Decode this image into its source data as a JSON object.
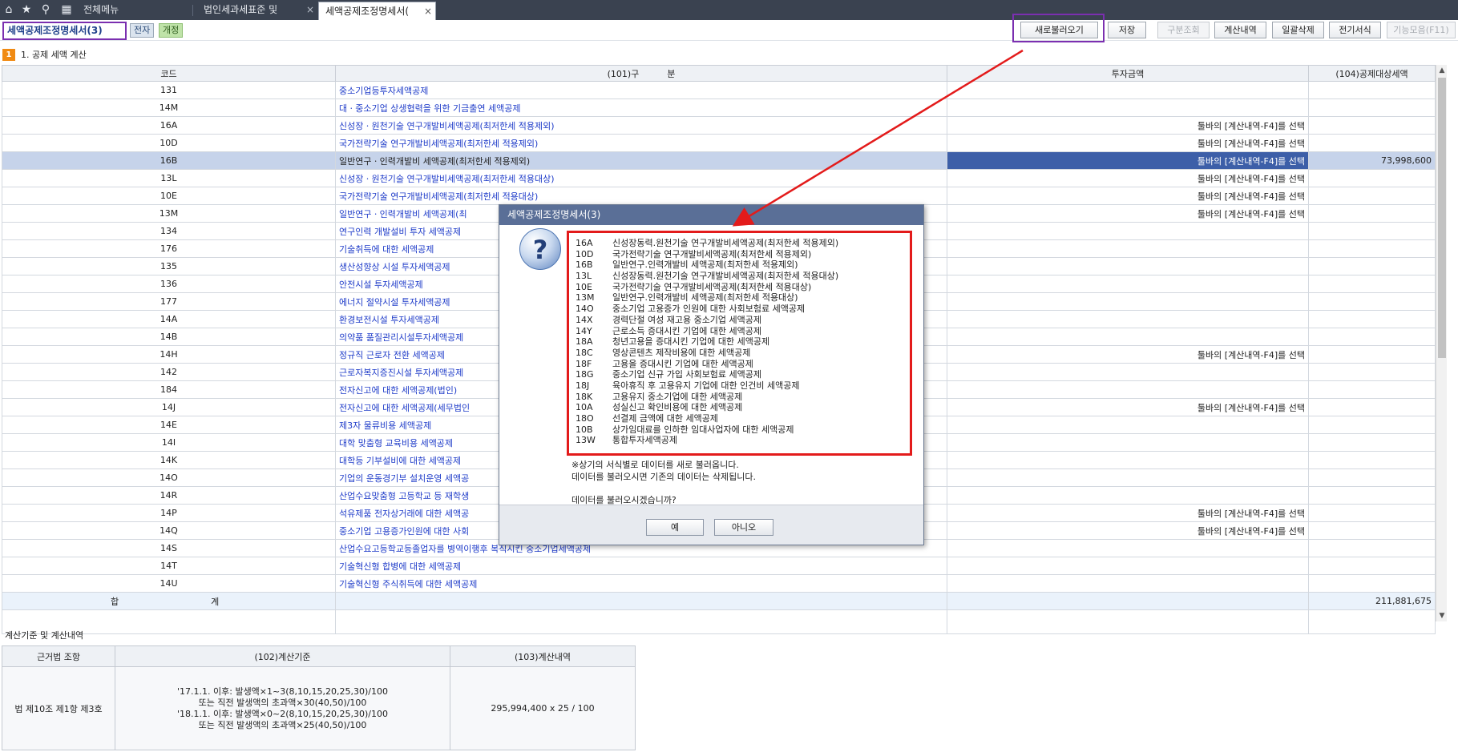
{
  "topbar": {
    "icons": [
      "home-icon",
      "star-icon",
      "search-icon",
      "calendar-icon"
    ],
    "tabs": [
      {
        "label": "전체메뉴",
        "active": false
      },
      {
        "label": "법인세과세표준 및",
        "active": false
      },
      {
        "label": "세액공제조정명세서(",
        "active": true
      }
    ],
    "close_glyph": "×"
  },
  "toolbar": {
    "form_title": "세액공제조정명세서(3)",
    "chip_electronic": "전자",
    "chip_revised": "개정",
    "buttons": [
      {
        "label": "새로불러오기",
        "disabled": false
      },
      {
        "label": "저장",
        "disabled": false
      },
      {
        "label": "구분조회",
        "disabled": true
      },
      {
        "label": "계산내역",
        "disabled": false
      },
      {
        "label": "일괄삭제",
        "disabled": false
      },
      {
        "label": "전기서식",
        "disabled": false
      },
      {
        "label": "기능모음(F11)",
        "disabled": true
      }
    ]
  },
  "section1": {
    "number": "1",
    "title": "1. 공제 세액 계산"
  },
  "grid": {
    "headers": {
      "code": "코드",
      "name": "(101)구          분",
      "invest": "투자금액",
      "deduct": "(104)공제대상세액"
    },
    "rows": [
      {
        "code": "131",
        "name": "중소기업등투자세액공제",
        "invest": "",
        "deduct": ""
      },
      {
        "code": "14M",
        "name": "대ㆍ중소기업 상생협력을 위한 기금출연 세액공제",
        "invest": "",
        "deduct": ""
      },
      {
        "code": "16A",
        "name": "신성장ㆍ원천기술 연구개발비세액공제(최저한세 적용제외)",
        "invest": "툴바의 [계산내역-F4]를 선택",
        "deduct": ""
      },
      {
        "code": "10D",
        "name": "국가전략기술 연구개발비세액공제(최저한세 적용제외)",
        "invest": "툴바의 [계산내역-F4]를 선택",
        "deduct": ""
      },
      {
        "code": "16B",
        "name": "일반연구ㆍ인력개발비 세액공제(최저한세 적용제외)",
        "invest": "툴바의 [계산내역-F4]를 선택",
        "deduct": "73,998,600",
        "selected": true
      },
      {
        "code": "13L",
        "name": "신성장ㆍ원천기술 연구개발비세액공제(최저한세 적용대상)",
        "invest": "툴바의 [계산내역-F4]를 선택",
        "deduct": ""
      },
      {
        "code": "10E",
        "name": "국가전략기술 연구개발비세액공제(최저한세 적용대상)",
        "invest": "툴바의 [계산내역-F4]를 선택",
        "deduct": ""
      },
      {
        "code": "13M",
        "name": "일반연구ㆍ인력개발비 세액공제(최",
        "invest": "툴바의 [계산내역-F4]를 선택",
        "deduct": ""
      },
      {
        "code": "134",
        "name": "연구인력 개발설비 투자 세액공제",
        "invest": "",
        "deduct": ""
      },
      {
        "code": "176",
        "name": "기술취득에 대한 세액공제",
        "invest": "",
        "deduct": ""
      },
      {
        "code": "135",
        "name": "생산성향상 시설 투자세액공제",
        "invest": "",
        "deduct": ""
      },
      {
        "code": "136",
        "name": "안전시설 투자세액공제",
        "invest": "",
        "deduct": ""
      },
      {
        "code": "177",
        "name": "에너지 절약시설 투자세액공제",
        "invest": "",
        "deduct": ""
      },
      {
        "code": "14A",
        "name": "환경보전시설 투자세액공제",
        "invest": "",
        "deduct": ""
      },
      {
        "code": "14B",
        "name": "의약품 품질관리시설투자세액공제",
        "invest": "",
        "deduct": ""
      },
      {
        "code": "14H",
        "name": "정규직 근로자 전환 세액공제",
        "invest": "툴바의 [계산내역-F4]를 선택",
        "deduct": ""
      },
      {
        "code": "142",
        "name": "근로자복지증진시설 투자세액공제",
        "invest": "",
        "deduct": ""
      },
      {
        "code": "184",
        "name": "전자신고에 대한 세액공제(법인)",
        "invest": "",
        "deduct": ""
      },
      {
        "code": "14J",
        "name": "전자신고에 대한 세액공제(세무법인",
        "invest": "툴바의 [계산내역-F4]를 선택",
        "deduct": ""
      },
      {
        "code": "14E",
        "name": "제3자 물류비용 세액공제",
        "invest": "",
        "deduct": ""
      },
      {
        "code": "14I",
        "name": "대학 맞춤형 교육비용 세액공제",
        "invest": "",
        "deduct": ""
      },
      {
        "code": "14K",
        "name": "대학등 기부설비에 대한 세액공제",
        "invest": "",
        "deduct": ""
      },
      {
        "code": "14O",
        "name": "기업의 운동경기부 설치운영 세액공",
        "invest": "",
        "deduct": ""
      },
      {
        "code": "14R",
        "name": "산업수요맞춤형 고등학교 등 재학생",
        "invest": "",
        "deduct": ""
      },
      {
        "code": "14P",
        "name": "석유제품 전자상거래에 대한 세액공",
        "invest": "툴바의 [계산내역-F4]를 선택",
        "deduct": ""
      },
      {
        "code": "14Q",
        "name": "중소기업 고용증가인원에 대한 사회",
        "invest": "툴바의 [계산내역-F4]를 선택",
        "deduct": ""
      },
      {
        "code": "14S",
        "name": "산업수요고등학교등졸업자를 병역이행후 복직시킨 중소기업세액공제",
        "invest": "",
        "deduct": ""
      },
      {
        "code": "14T",
        "name": "기술혁신형 합병에 대한 세액공제",
        "invest": "",
        "deduct": ""
      },
      {
        "code": "14U",
        "name": "기술혁신형 주식취득에 대한 세액공제",
        "invest": "",
        "deduct": ""
      }
    ],
    "total": {
      "label_left": "합",
      "label_right": "계",
      "deduct": "211,881,675"
    }
  },
  "bottom": {
    "title": "계산기준 및 계산내역",
    "headers": {
      "law": "근거법 조항",
      "basis": "(102)계산기준",
      "calc": "(103)계산내역"
    },
    "row": {
      "law": "법 제10조 제1항 제3호",
      "basis_lines": [
        "'17.1.1. 이후: 발생액×1~3(8,10,15,20,25,30)/100",
        "또는 직전 발생액의 초과액×30(40,50)/100",
        "'18.1.1. 이후: 발생액×0~2(8,10,15,20,25,30)/100",
        "또는 직전 발생액의 초과액×25(40,50)/100"
      ],
      "calc": "295,994,400 x 25 / 100"
    }
  },
  "dialog": {
    "title": "세액공제조정명세서(3)",
    "icon": "question-icon",
    "items": [
      {
        "code": "16A",
        "name": "신성장동력.원천기술 연구개발비세액공제(최저한세 적용제외)"
      },
      {
        "code": "10D",
        "name": "국가전략기술 연구개발비세액공제(최저한세 적용제외)"
      },
      {
        "code": "16B",
        "name": "일반연구.인력개발비 세액공제(최저한세 적용제외)"
      },
      {
        "code": "13L",
        "name": "신성장동력.원천기술 연구개발비세액공제(최저한세 적용대상)"
      },
      {
        "code": "10E",
        "name": "국가전략기술 연구개발비세액공제(최저한세 적용대상)"
      },
      {
        "code": "13M",
        "name": "일반연구.인력개발비 세액공제(최저한세 적용대상)"
      },
      {
        "code": "14O",
        "name": "중소기업 고용증가 인원에 대한 사회보험료 세액공제"
      },
      {
        "code": "14X",
        "name": "경력단절 여성 재고용 중소기업 세액공제"
      },
      {
        "code": "14Y",
        "name": "근로소득 증대시킨 기업에 대한 세액공제"
      },
      {
        "code": "18A",
        "name": "청년고용을 증대시킨 기업에 대한 세액공제"
      },
      {
        "code": "18C",
        "name": "영상콘텐츠 제작비용에 대한 세액공제"
      },
      {
        "code": "18F",
        "name": "고용을 증대시킨 기업에 대한 세액공제"
      },
      {
        "code": "18G",
        "name": "중소기업 신규 가입 사회보험료 세액공제"
      },
      {
        "code": "18J",
        "name": "육아휴직 후 고용유지 기업에 대한 인건비 세액공제"
      },
      {
        "code": "18K",
        "name": "고용유지 중소기업에 대한 세액공제"
      },
      {
        "code": "10A",
        "name": "성실신고 확인비용에 대한 세액공제"
      },
      {
        "code": "18O",
        "name": "선결제 금액에 대한 세액공제"
      },
      {
        "code": "10B",
        "name": "상가임대료를 인하한 임대사업자에 대한 세액공제"
      },
      {
        "code": "13W",
        "name": "통합투자세액공제"
      }
    ],
    "message_lines": [
      "※상기의 서식별로 데이터를 새로 불러옵니다.",
      "데이터를 불러오시면 기존의 데이터는 삭제됩니다.",
      "",
      "데이터를 불러오시겠습니까?"
    ],
    "yes_label": "예",
    "no_label": "아니오"
  },
  "colors": {
    "annotation_purple": "#7b2fb0",
    "annotation_red": "#e31b1b",
    "link_blue": "#1f3cc9",
    "selected_cell": "#3d5fa8"
  }
}
